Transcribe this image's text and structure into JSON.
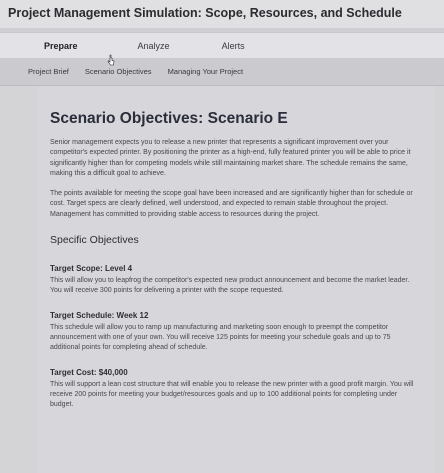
{
  "app": {
    "title": "Project Management Simulation: Scope, Resources, and Schedule"
  },
  "main_tabs": [
    {
      "label": "Prepare"
    },
    {
      "label": "Analyze"
    },
    {
      "label": "Alerts"
    }
  ],
  "sub_tabs": [
    {
      "label": "Project Brief"
    },
    {
      "label": "Scenario Objectives"
    },
    {
      "label": "Managing Your Project"
    }
  ],
  "page": {
    "heading": "Scenario Objectives: Scenario E",
    "paragraphs": [
      "Senior management expects you to release a new printer that represents a significant improvement over your competitor's expected printer. By positioning the printer as a high-end, fully featured printer you will be able to price it significantly higher than for competing models while still maintaining market share. The schedule remains the same, making this a difficult goal to achieve.",
      "The points available for meeting the scope goal have been increased and are significantly higher than for schedule or cost. Target specs are clearly defined, well understood, and expected to remain stable throughout the project. Management has committed to providing stable access to resources during the project."
    ],
    "section_heading": "Specific Objectives",
    "objectives": [
      {
        "title": "Target Scope: Level 4",
        "text": "This will allow you to leapfrog the competitor's expected new product announcement and become the market leader. You will receive 300 points for delivering a printer with the scope requested."
      },
      {
        "title": "Target Schedule: Week 12",
        "text": "This schedule will allow you to ramp up manufacturing and marketing soon enough to preempt the competitor announcement with one of your own. You will receive 125 points for meeting your schedule goals and up to 75 additional points for completing ahead of schedule."
      },
      {
        "title": "Target Cost: $40,000",
        "text": "This will support a lean cost structure that will enable you to release the new printer with a good profit margin. You will receive 200 points for meeting your budget/resources goals and up to 100 additional points for completing under budget."
      }
    ]
  }
}
